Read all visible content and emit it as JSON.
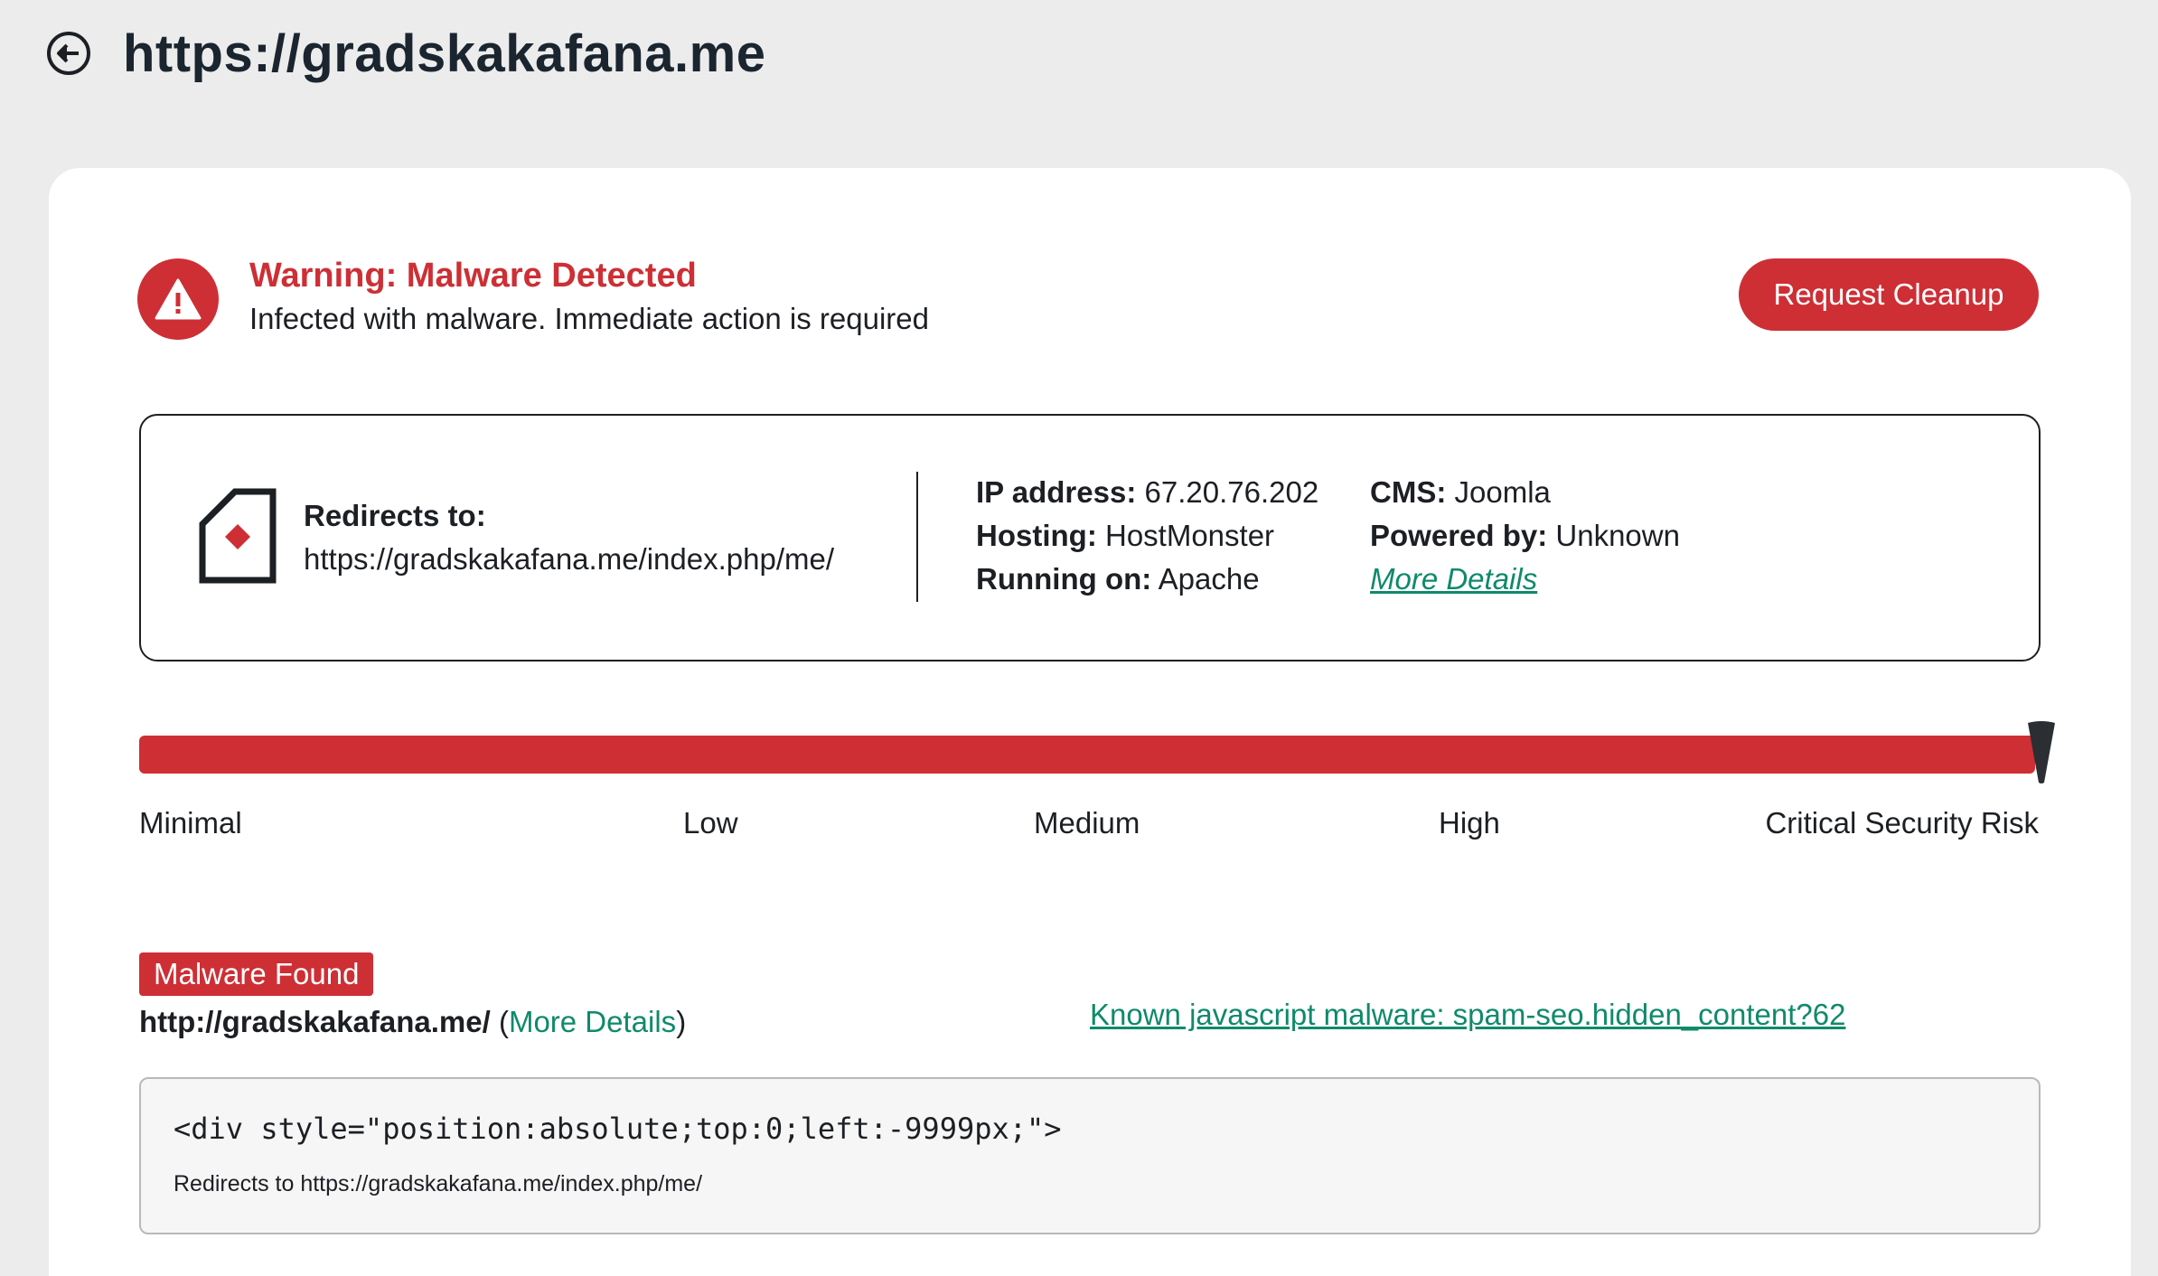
{
  "header": {
    "back_icon": "arrow-left-circle-icon",
    "site_url": "https://gradskakafana.me"
  },
  "warning": {
    "icon": "warning-triangle-icon",
    "title": "Warning: Malware Detected",
    "subtitle": "Infected with malware. Immediate action is required",
    "action_button": "Request Cleanup",
    "accent_color": "#cd2f35"
  },
  "info": {
    "redirect_icon": "redirect-page-icon",
    "redirect_label": "Redirects to:",
    "redirect_url": "https://gradskakafana.me/index.php/me/",
    "ip_label": "IP address:",
    "ip_value": "67.20.76.202",
    "hosting_label": "Hosting:",
    "hosting_value": "HostMonster",
    "running_label": "Running on:",
    "running_value": "Apache",
    "cms_label": "CMS:",
    "cms_value": "Joomla",
    "powered_label": "Powered by:",
    "powered_value": "Unknown",
    "more_details": "More Details"
  },
  "risk": {
    "levels": [
      "Minimal",
      "Low",
      "Medium",
      "High",
      "Critical Security Risk"
    ],
    "current_level": "Critical Security Risk",
    "fill_fraction": 1.0
  },
  "malware": {
    "badge": "Malware Found",
    "url": "http://gradskakafana.me/",
    "open_paren": " (",
    "more_details": "More Details",
    "close_paren": ")",
    "known_signature": "Known javascript malware: spam-seo.hidden_content?62",
    "code": "<div style=\"position:absolute;top:0;left:-9999px;\">",
    "note": "Redirects to https://gradskakafana.me/index.php/me/"
  },
  "link_color": "#0f8a6b"
}
